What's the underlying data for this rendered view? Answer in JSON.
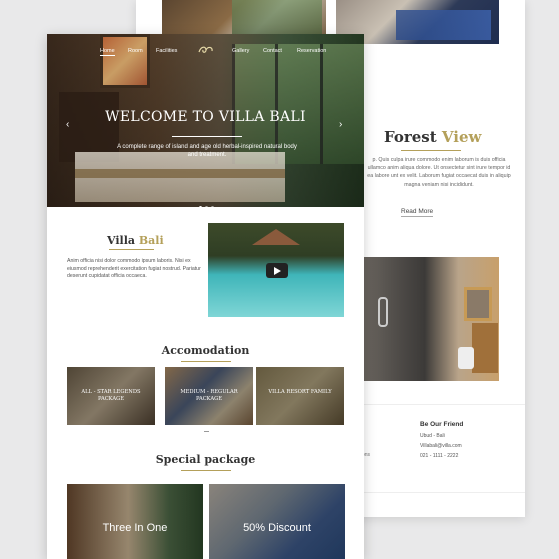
{
  "colors": {
    "accent": "#b4a05a",
    "text_dark": "#333333",
    "background": "#e9e9ea"
  },
  "back_page": {
    "forest": {
      "title_main": "Forest",
      "title_accent": "View",
      "paragraph": "p. Quis culpa irure commodo enim laborum is duis officia ullamco anim aliqua dolore. Ut onsectetur sint irure tempor id ea labore unt ex velit. Laborum fugiat occaecat duis in aliquip magna veniam nisi incididunt.",
      "read_more": "Read More"
    },
    "footer": {
      "friend_title": "Be Our Friend",
      "lines": [
        "Ubud - Bali",
        "Villabali@villa.com",
        "021 - 1111 - 2222"
      ],
      "left_fragments": [
        "r",
        "ons"
      ]
    }
  },
  "front_page": {
    "nav": {
      "items": [
        "Home",
        "Room",
        "Facilities",
        "Gallery",
        "Contact",
        "Reservation"
      ],
      "active": "Home",
      "logo_icon": "swirl-logo-icon"
    },
    "hero": {
      "title": "WELCOME TO VILLA BALI",
      "subtitle": "A complete range of island and age old herbal-inspired natural body and treatment.",
      "prev_icon": "‹",
      "next_icon": "›",
      "slide_count": 3,
      "active_slide": 1
    },
    "villa": {
      "title_main": "Villa",
      "title_accent": "Bali",
      "paragraph": "Anim officia nisi dolor commodo ipsum laboris. Nisi ex eiusmod reprehenderit exercitation fugiat nostrud. Pariatur deserunt cupidatat officia occaeca.",
      "video_icon": "play-icon"
    },
    "accomodation": {
      "title": "Accomodation",
      "rooms": [
        {
          "label": "ALL - STAR LEGENDS PACKAGE"
        },
        {
          "label": "MEDIUM - REGULAR PACKAGE"
        },
        {
          "label": "VILLA RESORT FAMILY"
        }
      ]
    },
    "special": {
      "title": "Special package",
      "packages": [
        {
          "label": "Three In One"
        },
        {
          "label": "50% Discount"
        }
      ]
    }
  }
}
